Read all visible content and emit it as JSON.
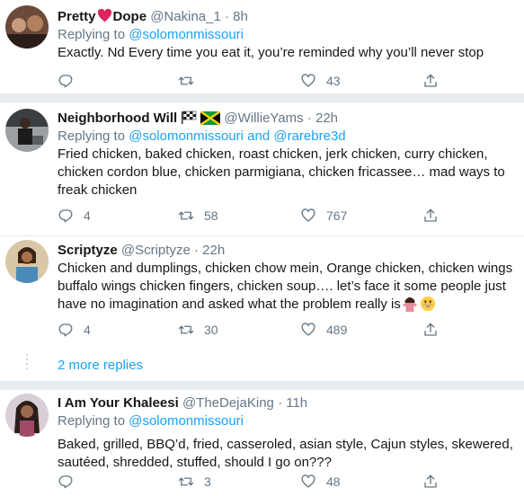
{
  "tweets": [
    {
      "name": "Pretty",
      "name_suffix": "Dope",
      "handle": "@Nakina_1",
      "time": "8h",
      "replying_label": "Replying to",
      "mentions": [
        "@solomonmissouri"
      ],
      "text": "Exactly. Nd Every time you eat it, you’re reminded why you’ll never stop",
      "replies": "",
      "retweets": "",
      "likes": "43"
    },
    {
      "name": "Neighborhood Will",
      "handle": "@WillieYams",
      "time": "22h",
      "replying_label": "Replying to",
      "mentions": [
        "@solomonmissouri",
        "@rarebre3d"
      ],
      "and_label": "and",
      "text": "Fried chicken, baked chicken, roast chicken, jerk chicken, curry chicken, chicken cordon blue, chicken parmigiana, chicken fricassee… mad ways to freak chicken",
      "replies": "4",
      "retweets": "58",
      "likes": "767"
    },
    {
      "name": "Scriptyze",
      "handle": "@Scriptyze",
      "time": "22h",
      "text": "Chicken and dumplings, chicken chow mein, Orange chicken, chicken wings buffalo wings chicken fingers, chicken soup…. let’s face it some people just have no imagination and asked what the problem really is",
      "replies": "4",
      "retweets": "30",
      "likes": "489"
    },
    {
      "name": "I Am Your Khaleesi",
      "handle": "@TheDejaKing",
      "time": "11h",
      "replying_label": "Replying to",
      "mentions": [
        "@solomonmissouri"
      ],
      "text": "Baked, grilled, BBQ’d, fried, casseroled, asian style, Cajun styles, skewered, sautéed, shredded, stuffed, should I go on???",
      "replies": "",
      "retweets": "3",
      "likes": "48"
    }
  ],
  "more_replies": "2 more replies",
  "separator": "·",
  "colors": {
    "link": "#1da1f2",
    "secondary": "#657786",
    "divider": "#e6ecf0",
    "heart": "#e0245e"
  }
}
